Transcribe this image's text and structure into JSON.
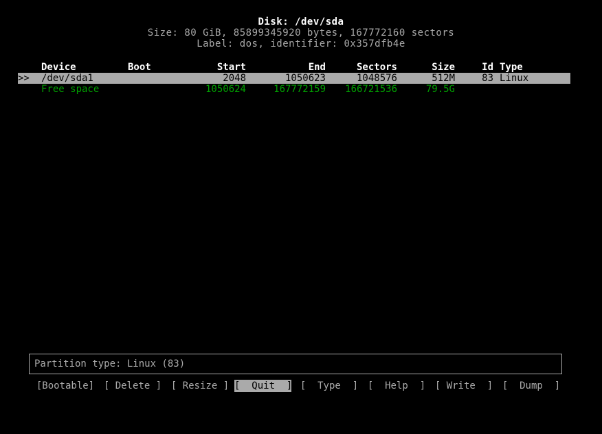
{
  "header": {
    "title": "Disk: /dev/sda",
    "size_line": "Size: 80 GiB, 85899345920 bytes, 167772160 sectors",
    "label_line": "Label: dos, identifier: 0x357dfb4e"
  },
  "table": {
    "columns": {
      "device": "Device",
      "boot": "Boot",
      "start": "Start",
      "end": "End",
      "sectors": "Sectors",
      "size": "Size",
      "id": "Id",
      "type": "Type"
    },
    "selection_marker": ">>",
    "rows": [
      {
        "marker": ">>",
        "device": "/dev/sda1",
        "boot": "",
        "start": "2048",
        "end": "1050623",
        "sectors": "1048576",
        "size": "512M",
        "id": "83",
        "type": "Linux",
        "selected": true,
        "free": false
      },
      {
        "marker": "",
        "device": "Free space",
        "boot": "",
        "start": "1050624",
        "end": "167772159",
        "sectors": "166721536",
        "size": "79.5G",
        "id": "",
        "type": "",
        "selected": false,
        "free": true
      }
    ]
  },
  "infobox": {
    "text": "Partition type: Linux (83)"
  },
  "buttons": [
    {
      "label": "[Bootable]",
      "name": "bootable",
      "active": false
    },
    {
      "label": "[ Delete ]",
      "name": "delete",
      "active": false
    },
    {
      "label": "[ Resize ]",
      "name": "resize",
      "active": false
    },
    {
      "label": "[  Quit  ]",
      "name": "quit",
      "active": true
    },
    {
      "label": "[  Type  ]",
      "name": "type",
      "active": false
    },
    {
      "label": "[  Help  ]",
      "name": "help",
      "active": false
    },
    {
      "label": "[ Write  ]",
      "name": "write",
      "active": false
    },
    {
      "label": "[  Dump  ]",
      "name": "dump",
      "active": false
    }
  ],
  "colors": {
    "background": "#000000",
    "foreground": "#aaaaaa",
    "bright": "#ffffff",
    "free_space": "#00a000",
    "highlight_bg": "#aaaaaa",
    "highlight_fg": "#000000"
  }
}
